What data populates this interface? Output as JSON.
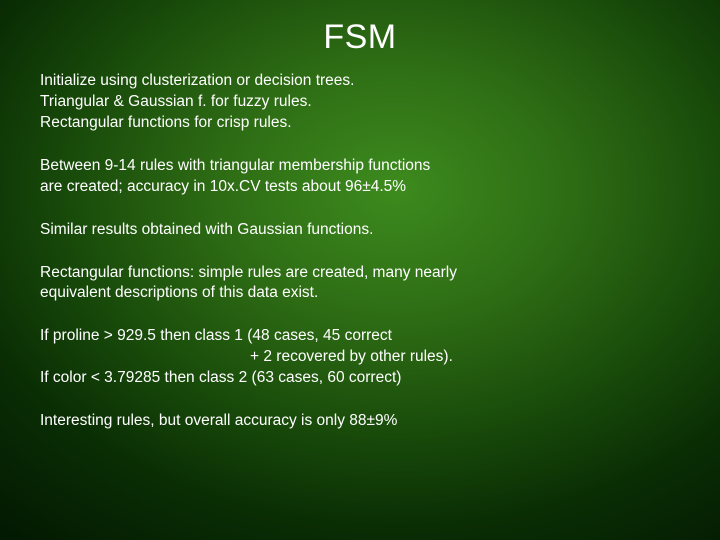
{
  "title": "FSM",
  "p1_l1": "Initialize using clusterization or decision trees.",
  "p1_l2": "Triangular & Gaussian f. for fuzzy rules.",
  "p1_l3": "Rectangular functions for crisp rules.",
  "p2_l1": "Between 9-14 rules with triangular membership functions",
  "p2_l2": "are created; accuracy in 10x.CV tests about 96±4.5%",
  "p3": "Similar results obtained with Gaussian functions.",
  "p4_l1": "Rectangular functions: simple rules are created, many nearly",
  "p4_l2": "equivalent descriptions of this data exist.",
  "p5_l1": "If proline > 929.5 then class 1 (48 cases, 45 correct",
  "p5_l2": "+ 2 recovered by other rules).",
  "p5_l3": "If color < 3.79285 then class 2 (63 cases, 60 correct)",
  "p6": "Interesting rules, but overall accuracy is only 88±9%"
}
